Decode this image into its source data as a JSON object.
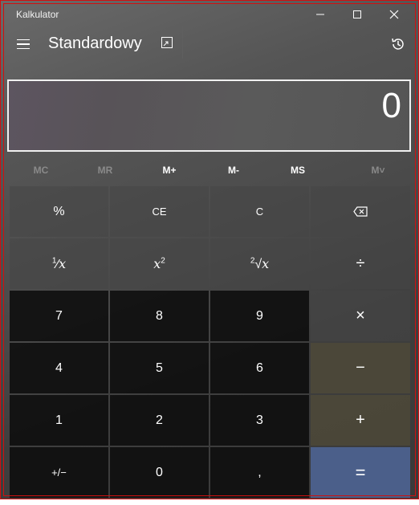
{
  "window": {
    "title": "Kalkulator"
  },
  "header": {
    "mode": "Standardowy"
  },
  "display": {
    "value": "0"
  },
  "memory": [
    {
      "label": "MC",
      "enabled": false
    },
    {
      "label": "MR",
      "enabled": false
    },
    {
      "label": "M+",
      "enabled": true
    },
    {
      "label": "M-",
      "enabled": true
    },
    {
      "label": "MS",
      "enabled": true
    },
    {
      "label": "M˅",
      "enabled": false
    }
  ],
  "keys": {
    "percent": "%",
    "ce": "CE",
    "c": "C",
    "seven": "7",
    "eight": "8",
    "nine": "9",
    "four": "4",
    "five": "5",
    "six": "6",
    "one": "1",
    "two": "2",
    "three": "3",
    "negate": "+/−",
    "zero": "0",
    "decimal": ",",
    "equals": "=",
    "divide": "÷",
    "multiply": "×",
    "minus": "−",
    "plus": "+"
  },
  "icons": {
    "close": "close-icon",
    "maximize": "maximize-icon",
    "minimize": "minimize-icon",
    "history": "history-icon",
    "menu": "hamburger-icon",
    "keep_on_top": "keep-on-top-icon",
    "backspace": "backspace-icon"
  },
  "colors": {
    "equals_bg": "#4b5f8a",
    "border": "#d01010"
  }
}
